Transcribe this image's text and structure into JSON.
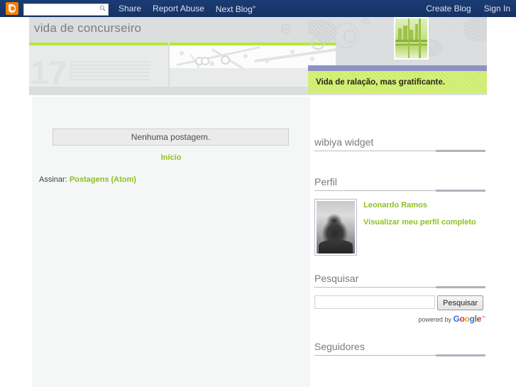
{
  "navbar": {
    "blogger_icon": "blogger-b-icon",
    "search_placeholder": "",
    "search_value": "",
    "search_icon": "search-magnifier-icon",
    "links": [
      {
        "label": "Share"
      },
      {
        "label": "Report Abuse"
      },
      {
        "label": "Next Blog",
        "suffix": "»"
      }
    ],
    "right_links": [
      {
        "label": "Create Blog"
      },
      {
        "label": "Sign In"
      }
    ],
    "background_color": "#19376d"
  },
  "header": {
    "blog_title": "vida de concurseiro",
    "blog_description": "Vida de ralação, mas gratificante.",
    "accent_green": "#b4e833",
    "desc_background": "#cdec6a",
    "purple_rule": "#8f91c4",
    "banner_number": "17",
    "banner_background": "#dcdddf"
  },
  "main": {
    "no_posts_text": "Nenhuma postagem.",
    "home_link": "Início",
    "subscribe_label": "Assinar:",
    "subscribe_link": "Postagens (Atom)",
    "link_color": "#8dc21f",
    "background_color": "#f5f6f6"
  },
  "sidebar": {
    "widgets": [
      {
        "title": "wibiya widget"
      },
      {
        "title": "Perfil"
      },
      {
        "title": "Pesquisar"
      },
      {
        "title": "Seguidores"
      }
    ],
    "profile": {
      "name": "Leonardo Ramos",
      "view_profile": "Visualizar meu perfil completo",
      "photo": "profile-avatar-photo"
    },
    "search": {
      "input_value": "",
      "input_placeholder": "",
      "button_label": "Pesquisar",
      "powered_by": "powered by",
      "google_g": "G",
      "google_o1": "o",
      "google_o2": "o",
      "google_g2": "g",
      "google_l": "l",
      "google_e": "e",
      "google_tm": "™"
    }
  }
}
